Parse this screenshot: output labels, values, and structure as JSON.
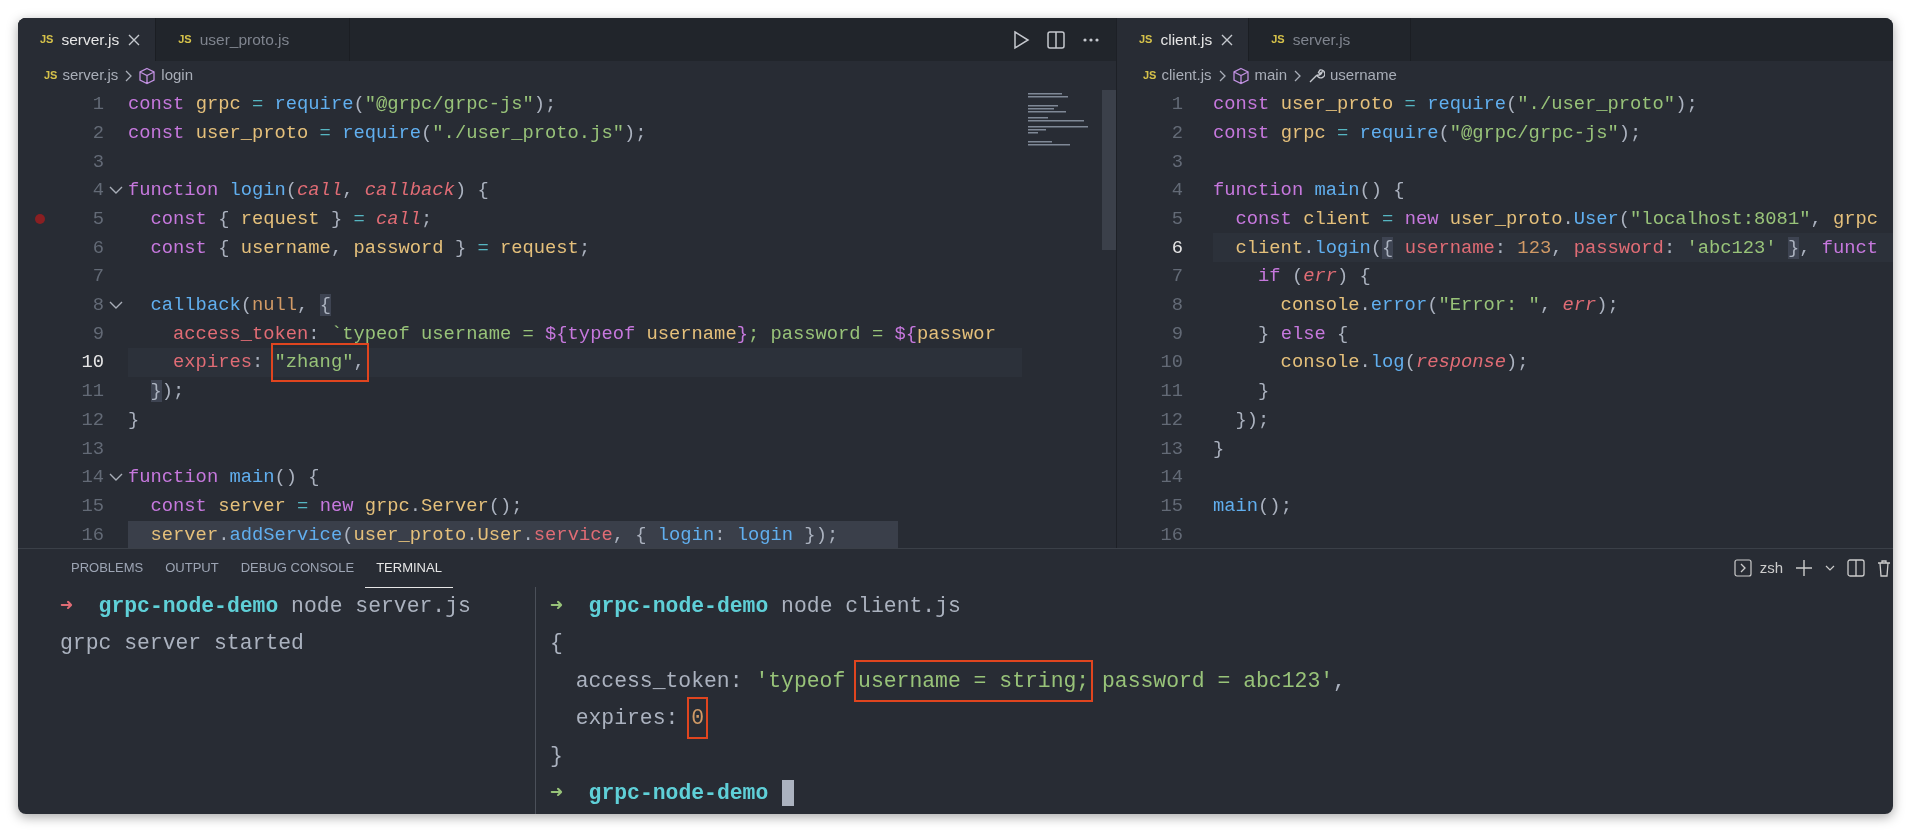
{
  "editors": [
    {
      "tabs": [
        {
          "badge": "JS",
          "label": "server.js",
          "selected": true
        },
        {
          "badge": "JS",
          "label": "user_proto.js",
          "selected": false
        }
      ],
      "breadcrumbs": [
        {
          "kind": "file",
          "badge": "JS",
          "label": "server.js"
        },
        {
          "kind": "symbol",
          "label": "login"
        }
      ],
      "lines": [
        {
          "number": "1",
          "tokens": [
            {
              "text": "const ",
              "kind": "keyword"
            },
            {
              "text": "grpc ",
              "kind": "variable"
            },
            {
              "text": "= ",
              "kind": "operator"
            },
            {
              "text": "require",
              "kind": "function"
            },
            {
              "text": "(",
              "kind": "plain"
            },
            {
              "text": "\"@grpc/grpc-js\"",
              "kind": "string"
            },
            {
              "text": ");",
              "kind": "plain"
            }
          ]
        },
        {
          "number": "2",
          "tokens": [
            {
              "text": "const ",
              "kind": "keyword"
            },
            {
              "text": "user_proto ",
              "kind": "variable"
            },
            {
              "text": "= ",
              "kind": "operator"
            },
            {
              "text": "require",
              "kind": "function"
            },
            {
              "text": "(",
              "kind": "plain"
            },
            {
              "text": "\"./user_proto.js\"",
              "kind": "string"
            },
            {
              "text": ");",
              "kind": "plain"
            }
          ]
        },
        {
          "number": "3"
        },
        {
          "number": "4",
          "foldable": true,
          "tokens": [
            {
              "text": "function ",
              "kind": "keyword"
            },
            {
              "text": "login",
              "kind": "function"
            },
            {
              "text": "(",
              "kind": "plain"
            },
            {
              "text": "call",
              "kind": "parameter"
            },
            {
              "text": ", ",
              "kind": "plain"
            },
            {
              "text": "callback",
              "kind": "parameter"
            },
            {
              "text": ") {",
              "kind": "plain"
            }
          ]
        },
        {
          "number": "5",
          "breakpoint": true,
          "tokens": [
            {
              "text": "  const",
              "kind": "keyword"
            },
            {
              "text": " { ",
              "kind": "plain"
            },
            {
              "text": "request",
              "kind": "variable"
            },
            {
              "text": " } ",
              "kind": "plain"
            },
            {
              "text": "= ",
              "kind": "operator"
            },
            {
              "text": "call",
              "kind": "parameter"
            },
            {
              "text": ";",
              "kind": "plain"
            }
          ]
        },
        {
          "number": "6",
          "tokens": [
            {
              "text": "  const",
              "kind": "keyword"
            },
            {
              "text": " { ",
              "kind": "plain"
            },
            {
              "text": "username",
              "kind": "variable"
            },
            {
              "text": ", ",
              "kind": "plain"
            },
            {
              "text": "password",
              "kind": "variable"
            },
            {
              "text": " } ",
              "kind": "plain"
            },
            {
              "text": "= ",
              "kind": "operator"
            },
            {
              "text": "request",
              "kind": "variable"
            },
            {
              "text": ";",
              "kind": "plain"
            }
          ]
        },
        {
          "number": "7"
        },
        {
          "number": "8",
          "foldable": true,
          "tokens": [
            {
              "text": "  callback",
              "kind": "function"
            },
            {
              "text": "(",
              "kind": "plain"
            },
            {
              "text": "null",
              "kind": "number"
            },
            {
              "text": ", ",
              "kind": "plain"
            },
            {
              "text": "{",
              "kind": "plain",
              "matched": true
            }
          ]
        },
        {
          "number": "9",
          "tokens": [
            {
              "text": "    access_token",
              "kind": "property"
            },
            {
              "text": ": ",
              "kind": "plain"
            },
            {
              "text": "`typeof username = ",
              "kind": "string"
            },
            {
              "text": "${typeof ",
              "kind": "keyword"
            },
            {
              "text": "username",
              "kind": "variable"
            },
            {
              "text": "}",
              "kind": "keyword"
            },
            {
              "text": "; password = ",
              "kind": "string"
            },
            {
              "text": "${",
              "kind": "keyword"
            },
            {
              "text": "passwor",
              "kind": "variable"
            }
          ]
        },
        {
          "number": "10",
          "current": true,
          "tokens": [
            {
              "text": "    expires",
              "kind": "property"
            },
            {
              "text": ": ",
              "kind": "plain"
            },
            {
              "text": "\"zhang\"",
              "kind": "string",
              "boxed": true
            },
            {
              "text": ",",
              "kind": "plain",
              "boxed": true
            }
          ]
        },
        {
          "number": "11",
          "tokens": [
            {
              "text": "  }",
              "kind": "plain",
              "matched": true
            },
            {
              "text": ");",
              "kind": "plain"
            }
          ]
        },
        {
          "number": "12",
          "tokens": [
            {
              "text": "}",
              "kind": "plain"
            }
          ]
        },
        {
          "number": "13"
        },
        {
          "number": "14",
          "foldable": true,
          "tokens": [
            {
              "text": "function ",
              "kind": "keyword"
            },
            {
              "text": "main",
              "kind": "function"
            },
            {
              "text": "() {",
              "kind": "plain"
            }
          ]
        },
        {
          "number": "15",
          "tokens": [
            {
              "text": "  const ",
              "kind": "keyword"
            },
            {
              "text": "server ",
              "kind": "variable"
            },
            {
              "text": "= ",
              "kind": "operator"
            },
            {
              "text": "new ",
              "kind": "keyword"
            },
            {
              "text": "grpc",
              "kind": "variable"
            },
            {
              "text": ".",
              "kind": "plain"
            },
            {
              "text": "Server",
              "kind": "variable"
            },
            {
              "text": "();",
              "kind": "plain"
            }
          ]
        },
        {
          "number": "16",
          "shaded": true,
          "tokens": [
            {
              "text": "  server",
              "kind": "variable"
            },
            {
              "text": ".",
              "kind": "plain"
            },
            {
              "text": "addService",
              "kind": "function"
            },
            {
              "text": "(",
              "kind": "plain"
            },
            {
              "text": "user_proto",
              "kind": "variable"
            },
            {
              "text": ".",
              "kind": "plain"
            },
            {
              "text": "User",
              "kind": "variable"
            },
            {
              "text": ".",
              "kind": "plain"
            },
            {
              "text": "service",
              "kind": "property"
            },
            {
              "text": ", { ",
              "kind": "plain"
            },
            {
              "text": "login",
              "kind": "function"
            },
            {
              "text": ": ",
              "kind": "plain"
            },
            {
              "text": "login",
              "kind": "function"
            },
            {
              "text": " });",
              "kind": "plain"
            }
          ]
        }
      ]
    },
    {
      "tabs": [
        {
          "badge": "JS",
          "label": "client.js",
          "selected": true
        },
        {
          "badge": "JS",
          "label": "server.js",
          "selected": false
        }
      ],
      "breadcrumbs": [
        {
          "kind": "file",
          "badge": "JS",
          "label": "client.js"
        },
        {
          "kind": "symbol",
          "label": "main"
        },
        {
          "kind": "property",
          "label": "username"
        }
      ],
      "lines": [
        {
          "number": "1",
          "tokens": [
            {
              "text": "const ",
              "kind": "keyword"
            },
            {
              "text": "user_proto ",
              "kind": "variable"
            },
            {
              "text": "= ",
              "kind": "operator"
            },
            {
              "text": "require",
              "kind": "function"
            },
            {
              "text": "(",
              "kind": "plain"
            },
            {
              "text": "\"./user_proto\"",
              "kind": "string"
            },
            {
              "text": ");",
              "kind": "plain"
            }
          ]
        },
        {
          "number": "2",
          "tokens": [
            {
              "text": "const ",
              "kind": "keyword"
            },
            {
              "text": "grpc ",
              "kind": "variable"
            },
            {
              "text": "= ",
              "kind": "operator"
            },
            {
              "text": "require",
              "kind": "function"
            },
            {
              "text": "(",
              "kind": "plain"
            },
            {
              "text": "\"@grpc/grpc-js\"",
              "kind": "string"
            },
            {
              "text": ");",
              "kind": "plain"
            }
          ]
        },
        {
          "number": "3"
        },
        {
          "number": "4",
          "tokens": [
            {
              "text": "function ",
              "kind": "keyword"
            },
            {
              "text": "main",
              "kind": "function"
            },
            {
              "text": "() {",
              "kind": "plain"
            }
          ]
        },
        {
          "number": "5",
          "tokens": [
            {
              "text": "  const ",
              "kind": "keyword"
            },
            {
              "text": "client ",
              "kind": "variable"
            },
            {
              "text": "= ",
              "kind": "operator"
            },
            {
              "text": "new ",
              "kind": "keyword"
            },
            {
              "text": "user_proto",
              "kind": "variable"
            },
            {
              "text": ".",
              "kind": "plain"
            },
            {
              "text": "User",
              "kind": "function"
            },
            {
              "text": "(",
              "kind": "plain"
            },
            {
              "text": "\"localhost:8081\"",
              "kind": "string"
            },
            {
              "text": ", ",
              "kind": "plain"
            },
            {
              "text": "grpc",
              "kind": "variable"
            }
          ]
        },
        {
          "number": "6",
          "current": true,
          "tokens": [
            {
              "text": "  client",
              "kind": "variable"
            },
            {
              "text": ".",
              "kind": "plain"
            },
            {
              "text": "login",
              "kind": "function"
            },
            {
              "text": "(",
              "kind": "plain"
            },
            {
              "text": "{",
              "kind": "plain",
              "matched": true
            },
            {
              "text": " username",
              "kind": "property"
            },
            {
              "text": ": ",
              "kind": "plain"
            },
            {
              "text": "123",
              "kind": "number"
            },
            {
              "text": ", ",
              "kind": "plain"
            },
            {
              "text": "password",
              "kind": "property"
            },
            {
              "text": ": ",
              "kind": "plain"
            },
            {
              "text": "'abc123' ",
              "kind": "string"
            },
            {
              "text": "}",
              "kind": "plain",
              "matched": true
            },
            {
              "text": ", ",
              "kind": "plain"
            },
            {
              "text": "funct",
              "kind": "keyword"
            }
          ]
        },
        {
          "number": "7",
          "tokens": [
            {
              "text": "    if",
              "kind": "keyword"
            },
            {
              "text": " (",
              "kind": "plain"
            },
            {
              "text": "err",
              "kind": "parameter"
            },
            {
              "text": ") {",
              "kind": "plain"
            }
          ]
        },
        {
          "number": "8",
          "tokens": [
            {
              "text": "      console",
              "kind": "variable"
            },
            {
              "text": ".",
              "kind": "plain"
            },
            {
              "text": "error",
              "kind": "function"
            },
            {
              "text": "(",
              "kind": "plain"
            },
            {
              "text": "\"Error: \"",
              "kind": "string"
            },
            {
              "text": ", ",
              "kind": "plain"
            },
            {
              "text": "err",
              "kind": "parameter"
            },
            {
              "text": ");",
              "kind": "plain"
            }
          ]
        },
        {
          "number": "9",
          "tokens": [
            {
              "text": "    } ",
              "kind": "plain"
            },
            {
              "text": "else",
              "kind": "keyword"
            },
            {
              "text": " {",
              "kind": "plain"
            }
          ]
        },
        {
          "number": "10",
          "tokens": [
            {
              "text": "      console",
              "kind": "variable"
            },
            {
              "text": ".",
              "kind": "plain"
            },
            {
              "text": "log",
              "kind": "function"
            },
            {
              "text": "(",
              "kind": "plain"
            },
            {
              "text": "response",
              "kind": "parameter"
            },
            {
              "text": ");",
              "kind": "plain"
            }
          ]
        },
        {
          "number": "11",
          "tokens": [
            {
              "text": "    }",
              "kind": "plain"
            }
          ]
        },
        {
          "number": "12",
          "tokens": [
            {
              "text": "  });",
              "kind": "plain"
            }
          ]
        },
        {
          "number": "13",
          "tokens": [
            {
              "text": "}",
              "kind": "plain"
            }
          ]
        },
        {
          "number": "14"
        },
        {
          "number": "15",
          "tokens": [
            {
              "text": "main",
              "kind": "function"
            },
            {
              "text": "();",
              "kind": "plain"
            }
          ]
        },
        {
          "number": "16"
        }
      ]
    }
  ],
  "panel": {
    "tabs": [
      {
        "label": "PROBLEMS",
        "selected": false
      },
      {
        "label": "OUTPUT",
        "selected": false
      },
      {
        "label": "DEBUG CONSOLE",
        "selected": false
      },
      {
        "label": "TERMINAL",
        "selected": true
      }
    ],
    "shell": "zsh",
    "terminals": [
      {
        "lines": [
          {
            "tokens": [
              {
                "text": "➜  ",
                "kind": "prompt-error"
              },
              {
                "text": "grpc-node-demo",
                "kind": "directory"
              },
              {
                "text": " node server.js",
                "kind": "plain"
              }
            ]
          },
          {
            "tokens": [
              {
                "text": "grpc server started",
                "kind": "plain"
              }
            ]
          }
        ]
      },
      {
        "lines": [
          {
            "tokens": [
              {
                "text": "➜  ",
                "kind": "prompt-ok"
              },
              {
                "text": "grpc-node-demo",
                "kind": "directory"
              },
              {
                "text": " node client.js",
                "kind": "plain"
              }
            ]
          },
          {
            "tokens": [
              {
                "text": "{",
                "kind": "plain"
              }
            ]
          },
          {
            "tokens": [
              {
                "text": "  access_token: ",
                "kind": "plain"
              },
              {
                "text": "'typeof ",
                "kind": "string"
              },
              {
                "text": "username = string;",
                "kind": "string",
                "boxed": true
              },
              {
                "text": " password = abc123'",
                "kind": "string"
              },
              {
                "text": ",",
                "kind": "plain"
              }
            ]
          },
          {
            "tokens": [
              {
                "text": "  expires: ",
                "kind": "plain"
              },
              {
                "text": "0",
                "kind": "number",
                "boxed": true
              }
            ]
          },
          {
            "tokens": [
              {
                "text": "}",
                "kind": "plain"
              }
            ]
          },
          {
            "cursor": true,
            "tokens": [
              {
                "text": "➜  ",
                "kind": "prompt-ok"
              },
              {
                "text": "grpc-node-demo",
                "kind": "directory"
              }
            ]
          }
        ]
      }
    ]
  }
}
